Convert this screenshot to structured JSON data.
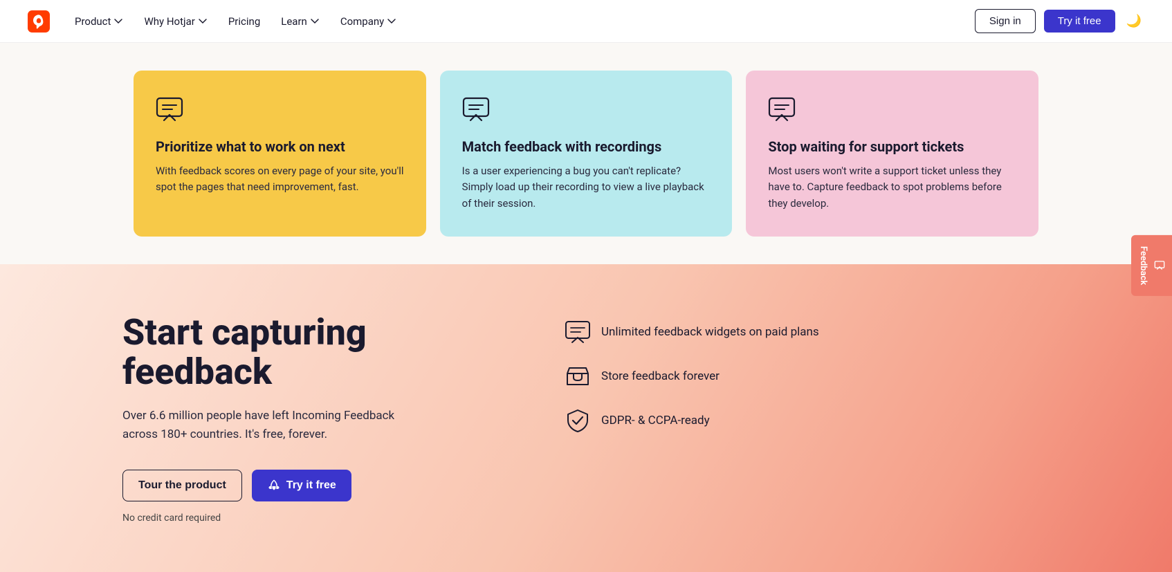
{
  "nav": {
    "logo_text": "hotjar",
    "links": [
      {
        "label": "Product",
        "has_dropdown": true
      },
      {
        "label": "Why Hotjar",
        "has_dropdown": true
      },
      {
        "label": "Pricing",
        "has_dropdown": false
      },
      {
        "label": "Learn",
        "has_dropdown": true
      },
      {
        "label": "Company",
        "has_dropdown": true
      }
    ],
    "signin_label": "Sign in",
    "try_label": "Try it free",
    "dark_mode_icon": "🌙"
  },
  "cards": [
    {
      "bg": "card-yellow",
      "title": "Prioritize what to work on next",
      "desc": "With feedback scores on every page of your site, you'll spot the pages that need improvement, fast."
    },
    {
      "bg": "card-cyan",
      "title": "Match feedback with recordings",
      "desc": "Is a user experiencing a bug you can't replicate? Simply load up their recording to view a live playback of their session."
    },
    {
      "bg": "card-pink",
      "title": "Stop waiting for support tickets",
      "desc": "Most users won't write a support ticket unless they have to. Capture feedback to spot problems before they develop."
    }
  ],
  "cta": {
    "title": "Start capturing feedback",
    "subtitle": "Over 6.6 million people have left Incoming Feedback across 180+ countries. It's free, forever.",
    "btn_tour": "Tour the product",
    "btn_try": "Try it free",
    "no_card": "No credit card required",
    "features": [
      {
        "text": "Unlimited feedback widgets on paid plans"
      },
      {
        "text": "Store feedback forever"
      },
      {
        "text": "GDPR- & CCPA-ready"
      }
    ]
  },
  "feedback_tab": "Feedback"
}
